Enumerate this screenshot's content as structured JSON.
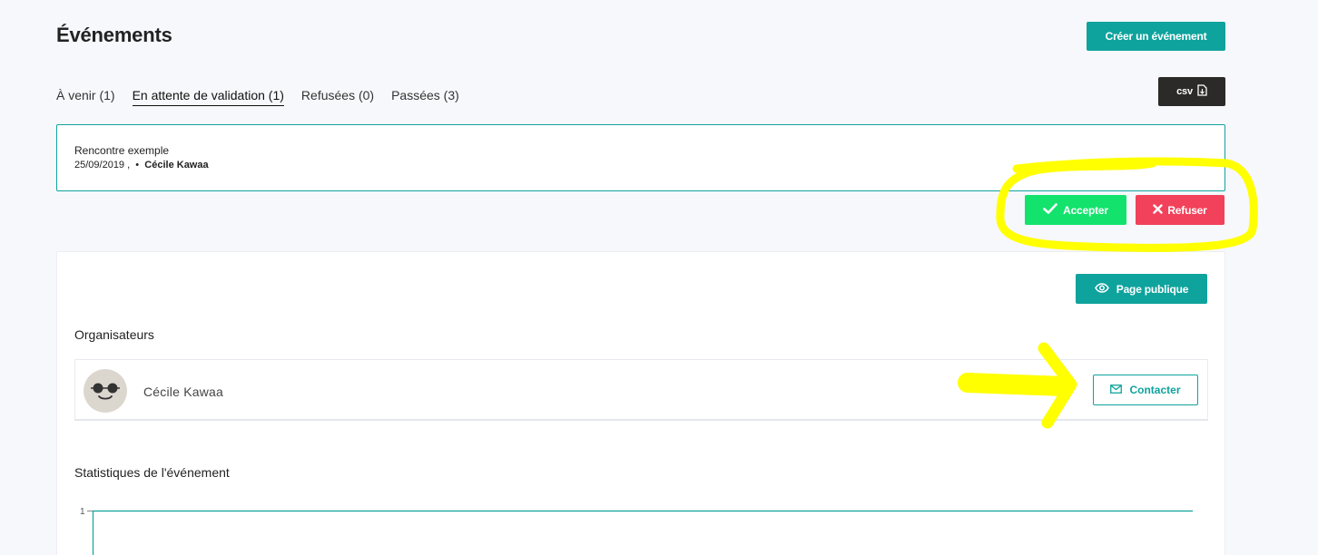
{
  "header": {
    "title": "Événements",
    "create_button": "Créer un événement",
    "csv_button": "csv"
  },
  "tabs": [
    {
      "label": "À venir (1)",
      "active": false
    },
    {
      "label": "En attente de validation (1)",
      "active": true
    },
    {
      "label": "Refusées (0)",
      "active": false
    },
    {
      "label": "Passées (3)",
      "active": false
    }
  ],
  "event": {
    "title": "Rencontre exemple",
    "date": "25/09/2019 ,",
    "separator": "•",
    "author": "Cécile Kawaa"
  },
  "actions": {
    "accept_label": "Accepter",
    "refuse_label": "Refuser"
  },
  "panel": {
    "public_page_button": "Page publique",
    "organizers_title": "Organisateurs",
    "organizer_name": "Cécile Kawaa",
    "contact_button": "Contacter",
    "stats_title": "Statistiques de l'événement",
    "chart_tick": "1"
  },
  "colors": {
    "accent": "#0fa39d",
    "accept": "#13e36c",
    "refuse": "#f2415a",
    "dark": "#2c2a28",
    "highlight": "#ffff00"
  }
}
